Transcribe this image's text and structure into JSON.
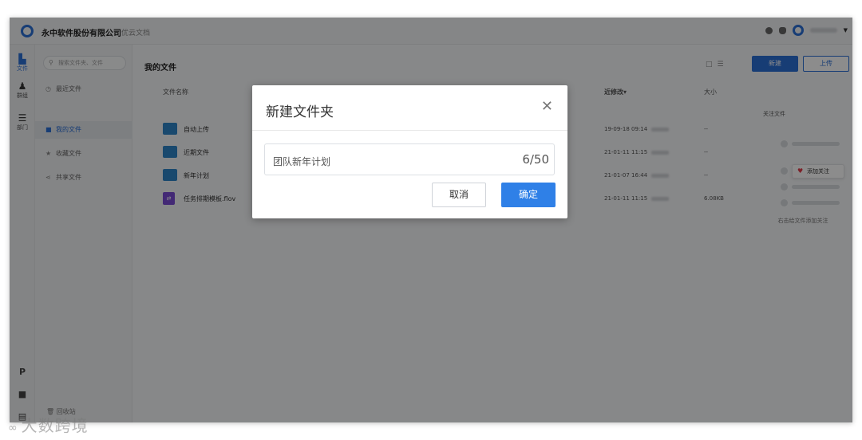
{
  "topbar": {
    "company": "永中软件股份有限公司",
    "app_name": "优云文档"
  },
  "rail": {
    "items": [
      {
        "label": "文件",
        "icon": "file-icon"
      },
      {
        "label": "群组",
        "icon": "group-icon"
      },
      {
        "label": "部门",
        "icon": "department-icon"
      }
    ]
  },
  "sidebar": {
    "search_placeholder": "搜索文件夹、文件",
    "items": [
      {
        "label": "最近文件",
        "icon": "clock-icon"
      },
      {
        "label": "我的文件",
        "icon": "folder-icon"
      },
      {
        "label": "收藏文件",
        "icon": "star-icon"
      },
      {
        "label": "共享文件",
        "icon": "share-icon"
      }
    ],
    "recycle": "回收站"
  },
  "main": {
    "title": "我的文件",
    "new_button": "新建",
    "upload_button": "上传",
    "columns": {
      "name": "文件名称",
      "modified": "近修改",
      "size": "大小"
    },
    "rows": [
      {
        "name": "自动上传",
        "date": "19-09-18 09:14",
        "size": "--",
        "type": "folder"
      },
      {
        "name": "近期文件",
        "date": "21-01-11 11:15",
        "size": "--",
        "type": "folder"
      },
      {
        "name": "新年计划",
        "date": "21-01-07 16:44",
        "size": "--",
        "type": "folder"
      },
      {
        "name": "任务排期模板.flov",
        "date": "21-01-11 11:15",
        "size": "6.08KB",
        "type": "template"
      }
    ]
  },
  "follow_panel": {
    "title": "关注文件",
    "add_label": "添加关注",
    "hint": "右击给文件添加关注"
  },
  "dialog": {
    "title": "新建文件夹",
    "input_value": "团队新年计划",
    "char_count": "6/50",
    "cancel": "取消",
    "confirm": "确定"
  },
  "watermark": "大数跨境"
}
